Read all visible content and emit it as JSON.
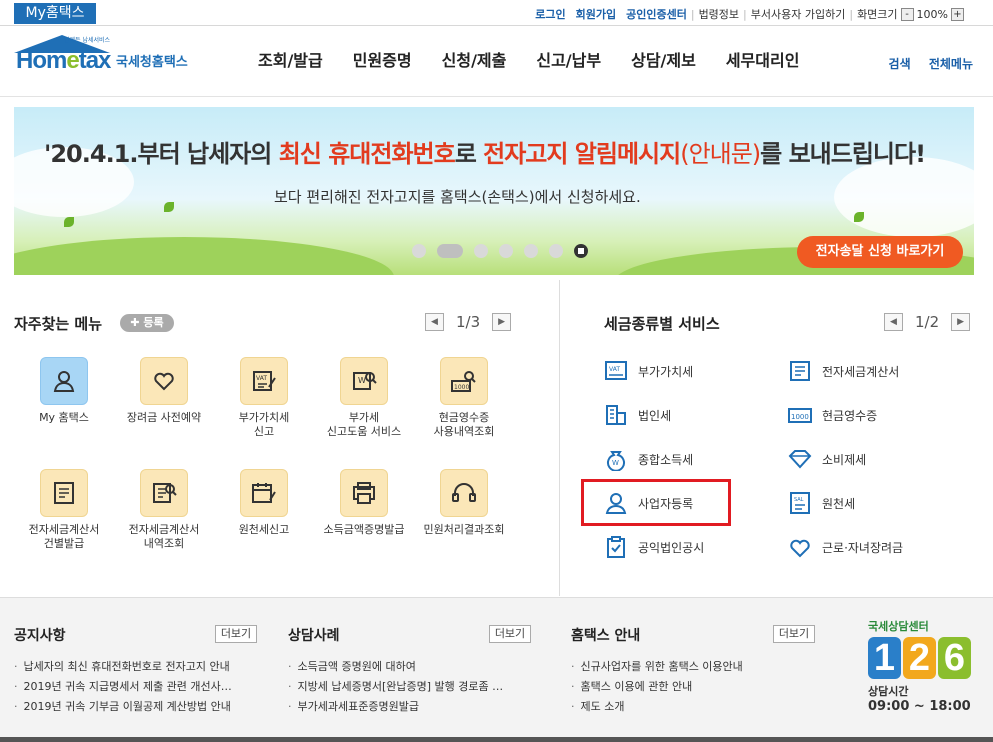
{
  "top": {
    "my_home": "My홈택스",
    "links_bold": [
      "로그인",
      "회원가입",
      "공인인증센터"
    ],
    "links_plain": [
      "법령정보",
      "부서사용자 가입하기",
      "화면크기"
    ],
    "zoom_minus": "-",
    "zoom_value": "100%",
    "zoom_plus": "+"
  },
  "logo": {
    "tiny": "언제든 납세서비스",
    "word_a": "Hom",
    "word_e": "e",
    "word_b": "tax",
    "sub": "국세청홈택스"
  },
  "gnb": [
    "조회/발급",
    "민원증명",
    "신청/제출",
    "신고/납부",
    "상담/제보",
    "세무대리인"
  ],
  "util": [
    "검색",
    "전체메뉴"
  ],
  "banner": {
    "title_a": "'20.4.1.부터 납세자의 ",
    "title_b": "최신 휴대전화번호",
    "title_c": "로 ",
    "title_d": "전자고지 알림메시지",
    "title_e": "(안내문)",
    "title_f": "를 보내드립니다!",
    "subtitle": "보다 편리해진 전자고지를 홈택스(손택스)에서 신청하세요.",
    "button": "전자송달 신청 바로가기"
  },
  "favorites": {
    "title": "자주찾는 메뉴",
    "register": "✚ 등록",
    "page": "1/3",
    "prev": "◀",
    "next": "▶",
    "items": [
      {
        "line1": "My 홈택스",
        "line2": ""
      },
      {
        "line1": "장려금 사전예약",
        "line2": ""
      },
      {
        "line1": "부가가치세",
        "line2": "신고"
      },
      {
        "line1": "부가세",
        "line2": "신고도움 서비스"
      },
      {
        "line1": "현금영수증",
        "line2": "사용내역조회"
      },
      {
        "line1": "전자세금계산서",
        "line2": "건별발급"
      },
      {
        "line1": "전자세금계산서",
        "line2": "내역조회"
      },
      {
        "line1": "원천세신고",
        "line2": ""
      },
      {
        "line1": "소득금액증명발급",
        "line2": ""
      },
      {
        "line1": "민원처리결과조회",
        "line2": ""
      }
    ]
  },
  "taxes": {
    "title": "세금종류별 서비스",
    "page": "1/2",
    "prev": "◀",
    "next": "▶",
    "items": [
      "부가가치세",
      "전자세금계산서",
      "법인세",
      "현금영수증",
      "종합소득세",
      "소비제세",
      "사업자등록",
      "원천세",
      "공익법인공시",
      "근로·자녀장려금"
    ]
  },
  "notice": {
    "title": "공지사항",
    "more": "더보기",
    "items": [
      "납세자의 최신 휴대전화번호로 전자고지 안내",
      "2019년 귀속 지급명세서 제출 관련 개선사…",
      "2019년 귀속 기부금 이월공제 계산방법 안내"
    ]
  },
  "consult": {
    "title": "상담사례",
    "more": "더보기",
    "items": [
      "소득금액 증명원에 대하여",
      "지방세 납세증명서[완납증명] 발행 경로좀 …",
      "부가세과세표준증명원발급"
    ]
  },
  "guide": {
    "title": "홈택스 안내",
    "more": "더보기",
    "items": [
      "신규사업자를 위한 홈택스 이용안내",
      "홈택스 이용에 관한 안내",
      "제도 소개"
    ]
  },
  "callcenter": {
    "label": "국세상담센터",
    "digits": [
      "1",
      "2",
      "6"
    ],
    "hours_label": "상담시간",
    "hours": "09:00 ~ 18:00"
  },
  "colors": {
    "brand": "#1f6fb6",
    "accent": "#f05a22",
    "highlight": "#e11b22"
  }
}
